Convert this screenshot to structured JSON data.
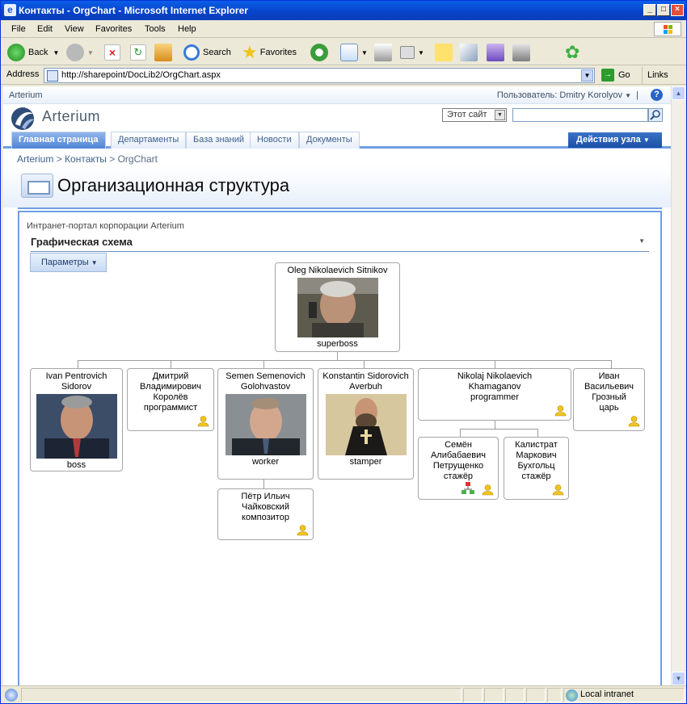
{
  "browser": {
    "title": "Контакты - OrgChart - Microsoft Internet Explorer",
    "menu": [
      "File",
      "Edit",
      "View",
      "Favorites",
      "Tools",
      "Help"
    ],
    "toolbar": {
      "back": "Back",
      "search": "Search",
      "favorites": "Favorites"
    },
    "address_label": "Address",
    "url": "http://sharepoint/DocLib2/OrgChart.aspx",
    "go": "Go",
    "links": "Links",
    "status_zone": "Local intranet"
  },
  "sharepoint": {
    "site_name": "Arterium",
    "user": "Пользователь: Dmitry Korolyov",
    "logo_text": "Arterium",
    "scope": "Этот сайт",
    "tabs": [
      "Главная страница",
      "Департаменты",
      "База знаний",
      "Новости",
      "Документы"
    ],
    "site_actions": "Действия узла",
    "breadcrumb": {
      "a": "Arterium",
      "b": "Контакты",
      "c": "OrgChart",
      "sep": ">"
    },
    "page_title": "Организационная структура",
    "web_title": "Интранет-портал корпорации Arterium",
    "view": "Графическая схема",
    "params_button": "Параметры"
  },
  "org": {
    "root": {
      "name": "Oleg Nikolaevich Sitnikov",
      "role": "superboss"
    },
    "n1": {
      "name": "Ivan Pentrovich Sidorov",
      "role": "boss"
    },
    "n2": {
      "name": "Дмитрий Владимирович Королёв",
      "role": "программист"
    },
    "n3": {
      "name": "Semen Semenovich Golohvastov",
      "role": "worker"
    },
    "n3c": {
      "name": "Пётр Ильич Чайковский",
      "role": "композитор"
    },
    "n4": {
      "name": "Konstantin Sidorovich Averbuh",
      "role": "stamper"
    },
    "n5": {
      "name": "Nikolaj Nikolaevich Khamaganov",
      "role": "programmer"
    },
    "n5a": {
      "name": "Семён Алибабаевич Петрущенко",
      "role": "стажёр"
    },
    "n5b": {
      "name": "Калистрат Маркович Бухгольц",
      "role": "стажёр"
    },
    "n6": {
      "name": "Иван Васильевич Грозный",
      "role": "царь"
    }
  }
}
